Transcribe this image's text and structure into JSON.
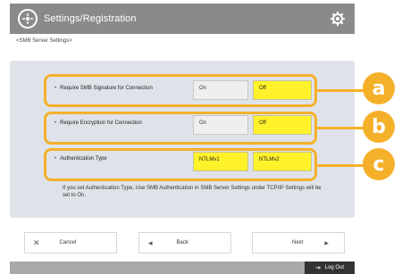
{
  "header": {
    "title": "Settings/Registration"
  },
  "breadcrumb": "<SMB Server Settings>",
  "rows": [
    {
      "label": "Require SMB Signature for Connection",
      "options": [
        {
          "label": "On",
          "selected": false
        },
        {
          "label": "Off",
          "selected": true
        }
      ],
      "badge": "a"
    },
    {
      "label": "Require Encryption for Connection",
      "options": [
        {
          "label": "On",
          "selected": false
        },
        {
          "label": "Off",
          "selected": true
        }
      ],
      "badge": "b"
    },
    {
      "label": "Authentication Type",
      "options": [
        {
          "label": "NTLMv1",
          "selected": true
        },
        {
          "label": "NTLMv2",
          "selected": true
        }
      ],
      "badge": "c"
    }
  ],
  "note": "If you set Authentication Type, Use SMB Authentication in SMB Server Settings under TCP/IP Settings will be set to On.",
  "nav": {
    "cancel": "Cancel",
    "back": "Back",
    "next": "Next"
  },
  "footer": {
    "logout": "Log Out"
  },
  "colors": {
    "accent": "#f5b02a",
    "selected": "#fff22a",
    "header": "#8a8a8a"
  }
}
